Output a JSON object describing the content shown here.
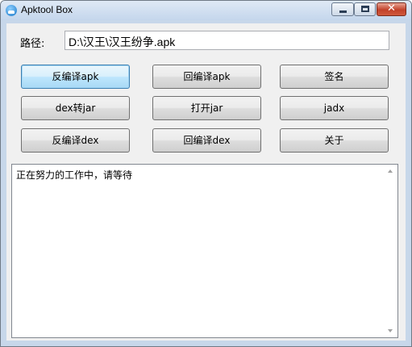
{
  "window": {
    "title": "Apktool Box",
    "close_symbol": "✕"
  },
  "path": {
    "label": "路径:",
    "value": "D:\\汉王\\汉王纷争.apk"
  },
  "buttons": {
    "decompile_apk": "反编译apk",
    "recompile_apk": "回编译apk",
    "sign": "签名",
    "dex_to_jar": "dex转jar",
    "open_jar": "打开jar",
    "jadx": "jadx",
    "decompile_dex": "反编译dex",
    "recompile_dex": "回编译dex",
    "about": "关于"
  },
  "log": {
    "text": "正在努力的工作中，请等待"
  },
  "icons": {
    "app": "apktool-cloud-icon",
    "minimize": "minimize-icon",
    "maximize": "maximize-icon",
    "close": "close-icon"
  },
  "colors": {
    "title_bar": "#c4d6ec",
    "close_button": "#c2412a",
    "focused_button": "#bee6fd"
  }
}
